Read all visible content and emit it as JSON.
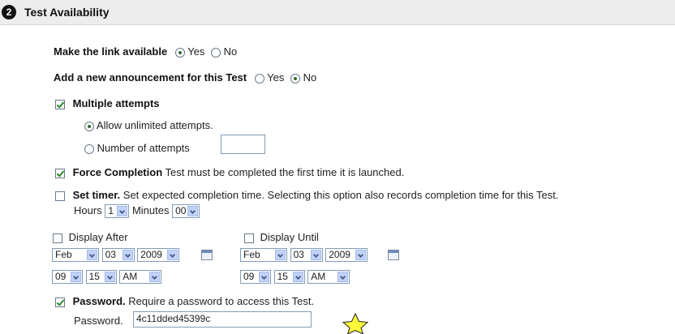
{
  "section": {
    "number": "2",
    "title": "Test Availability"
  },
  "availability": {
    "label": "Make the link available",
    "yes": "Yes",
    "no": "No",
    "selected": "Yes"
  },
  "announcement": {
    "label": "Add a new announcement for this Test",
    "yes": "Yes",
    "no": "No",
    "selected": "No"
  },
  "attempts": {
    "label": "Multiple attempts",
    "checked": true,
    "unlimited_label": "Allow unlimited attempts.",
    "number_label": "Number of attempts",
    "number_value": "",
    "selected": "unlimited"
  },
  "force_completion": {
    "label": "Force Completion",
    "desc": "Test must be completed the first time it is launched.",
    "checked": true
  },
  "timer": {
    "label": "Set timer.",
    "desc": "Set expected completion time. Selecting this option also records completion time for this Test.",
    "checked": false,
    "hours_label": "Hours",
    "hours": "1",
    "minutes_label": "Minutes",
    "minutes": "00"
  },
  "display_after": {
    "label": "Display After",
    "checked": false,
    "month": "Feb",
    "day": "03",
    "year": "2009",
    "hour": "09",
    "minute": "15",
    "ampm": "AM"
  },
  "display_until": {
    "label": "Display Until",
    "checked": false,
    "month": "Feb",
    "day": "03",
    "year": "2009",
    "hour": "09",
    "minute": "15",
    "ampm": "AM"
  },
  "password": {
    "label": "Password.",
    "desc": "Require a password to access this Test.",
    "checked": true,
    "field_label": "Password.",
    "value": "4c11dded45399c"
  },
  "colors": {
    "header_bg": "#ededed",
    "check_green": "#2b8a2b",
    "star_fill": "#fff93a"
  },
  "icons": {
    "step": "step-number-icon",
    "calendar": "calendar-icon",
    "star": "star-icon"
  }
}
